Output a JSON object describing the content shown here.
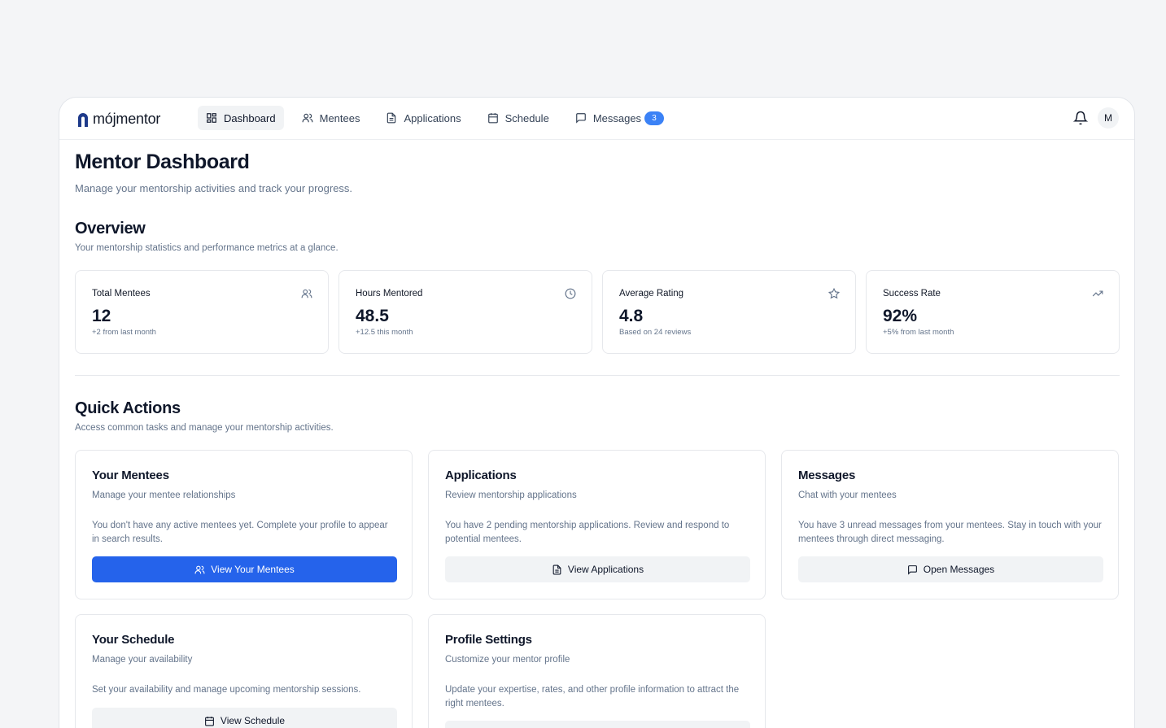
{
  "brand": {
    "name": "mójmentor"
  },
  "nav": {
    "items": [
      {
        "label": "Dashboard",
        "icon": "dashboard-icon",
        "active": true
      },
      {
        "label": "Mentees",
        "icon": "users-icon",
        "active": false
      },
      {
        "label": "Applications",
        "icon": "file-text-icon",
        "active": false
      },
      {
        "label": "Schedule",
        "icon": "calendar-icon",
        "active": false
      },
      {
        "label": "Messages",
        "icon": "message-square-icon",
        "active": false,
        "badge": "3"
      }
    ]
  },
  "header": {
    "avatar_initial": "M",
    "notifications_icon": "bell-icon"
  },
  "page": {
    "title": "Mentor Dashboard",
    "subtitle": "Manage your mentorship activities and track your progress."
  },
  "overview": {
    "title": "Overview",
    "description": "Your mentorship statistics and performance metrics at a glance.",
    "stats": [
      {
        "label": "Total Mentees",
        "value": "12",
        "sub": "+2 from last month",
        "icon": "users-icon"
      },
      {
        "label": "Hours Mentored",
        "value": "48.5",
        "sub": "+12.5 this month",
        "icon": "clock-icon"
      },
      {
        "label": "Average Rating",
        "value": "4.8",
        "sub": "Based on 24 reviews",
        "icon": "star-icon"
      },
      {
        "label": "Success Rate",
        "value": "92%",
        "sub": "+5% from last month",
        "icon": "trending-up-icon"
      }
    ]
  },
  "quick_actions": {
    "title": "Quick Actions",
    "description": "Access common tasks and manage your mentorship activities.",
    "cards": [
      {
        "title": "Your Mentees",
        "subtitle": "Manage your mentee relationships",
        "body": "You don't have any active mentees yet. Complete your profile to appear in search results.",
        "button": "View Your Mentees",
        "button_icon": "users-icon"
      },
      {
        "title": "Applications",
        "subtitle": "Review mentorship applications",
        "body": "You have 2 pending mentorship applications. Review and respond to potential mentees.",
        "button": "View Applications",
        "button_icon": "file-text-icon"
      },
      {
        "title": "Messages",
        "subtitle": "Chat with your mentees",
        "body": "You have 3 unread messages from your mentees. Stay in touch with your mentees through direct messaging.",
        "button": "Open Messages",
        "button_icon": "message-square-icon"
      },
      {
        "title": "Your Schedule",
        "subtitle": "Manage your availability",
        "body": "Set your availability and manage upcoming mentorship sessions.",
        "button": "View Schedule",
        "button_icon": "calendar-icon"
      },
      {
        "title": "Profile Settings",
        "subtitle": "Customize your mentor profile",
        "body": "Update your expertise, rates, and other profile information to attract the right mentees.",
        "button": "",
        "button_icon": ""
      }
    ]
  },
  "colors": {
    "primary": "#2563eb",
    "badge": "#3b82f6",
    "muted_text": "#64748b",
    "background": "#f4f5f7"
  }
}
